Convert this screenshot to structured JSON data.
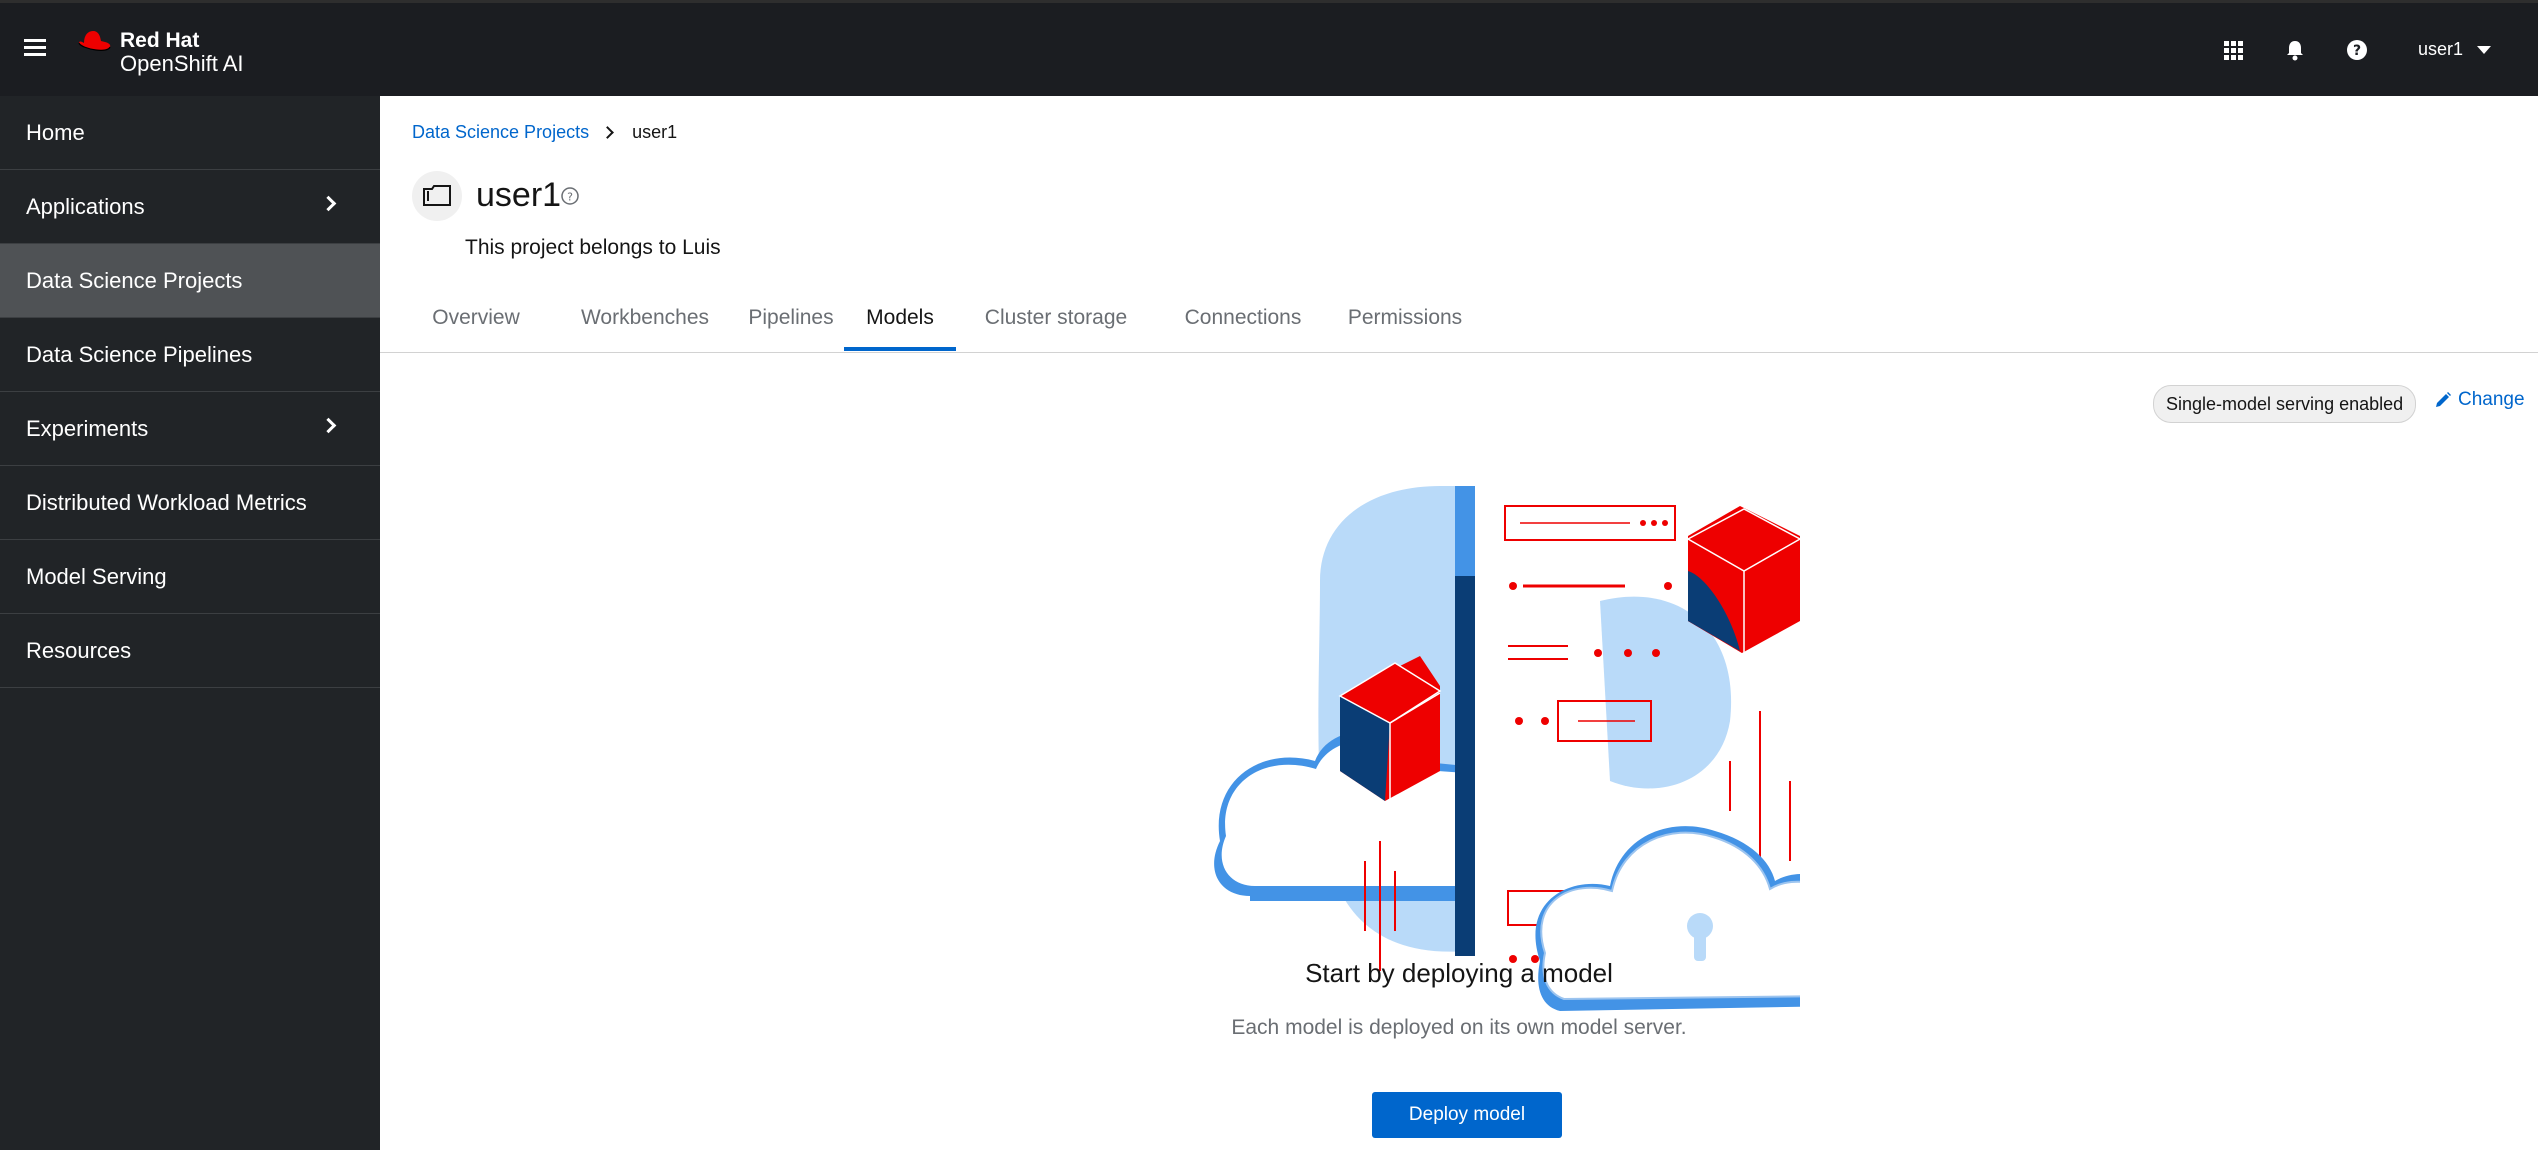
{
  "masthead": {
    "brand_line1": "Red Hat",
    "brand_line2": "OpenShift AI",
    "icons": [
      "hamburger-icon",
      "app-launcher-icon",
      "notification-bell-icon",
      "help-icon"
    ],
    "user": "user1"
  },
  "sidebar": {
    "items": [
      {
        "label": "Home",
        "expandable": false,
        "active": false
      },
      {
        "label": "Applications",
        "expandable": true,
        "active": false
      },
      {
        "label": "Data Science Projects",
        "expandable": false,
        "active": true
      },
      {
        "label": "Data Science Pipelines",
        "expandable": false,
        "active": false
      },
      {
        "label": "Experiments",
        "expandable": true,
        "active": false
      },
      {
        "label": "Distributed Workload Metrics",
        "expandable": false,
        "active": false
      },
      {
        "label": "Model Serving",
        "expandable": false,
        "active": false
      },
      {
        "label": "Resources",
        "expandable": false,
        "active": false
      }
    ]
  },
  "breadcrumb": {
    "parent": "Data Science Projects",
    "current": "user1"
  },
  "project": {
    "title": "user1",
    "description": "This project belongs to Luis"
  },
  "tabs": [
    {
      "label": "Overview",
      "active": false
    },
    {
      "label": "Workbenches",
      "active": false
    },
    {
      "label": "Pipelines",
      "active": false
    },
    {
      "label": "Models",
      "active": true
    },
    {
      "label": "Cluster storage",
      "active": false
    },
    {
      "label": "Connections",
      "active": false
    },
    {
      "label": "Permissions",
      "active": false
    }
  ],
  "serving": {
    "badge": "Single-model serving enabled",
    "change_label": "Change"
  },
  "empty_state": {
    "title": "Start by deploying a model",
    "body": "Each model is deployed on its own model server.",
    "button": "Deploy model"
  },
  "colors": {
    "masthead": "#1b1d21",
    "sidebar": "#212427",
    "sidebar_active": "#4f5255",
    "link": "#0066cc",
    "brand_red": "#ee0000"
  }
}
